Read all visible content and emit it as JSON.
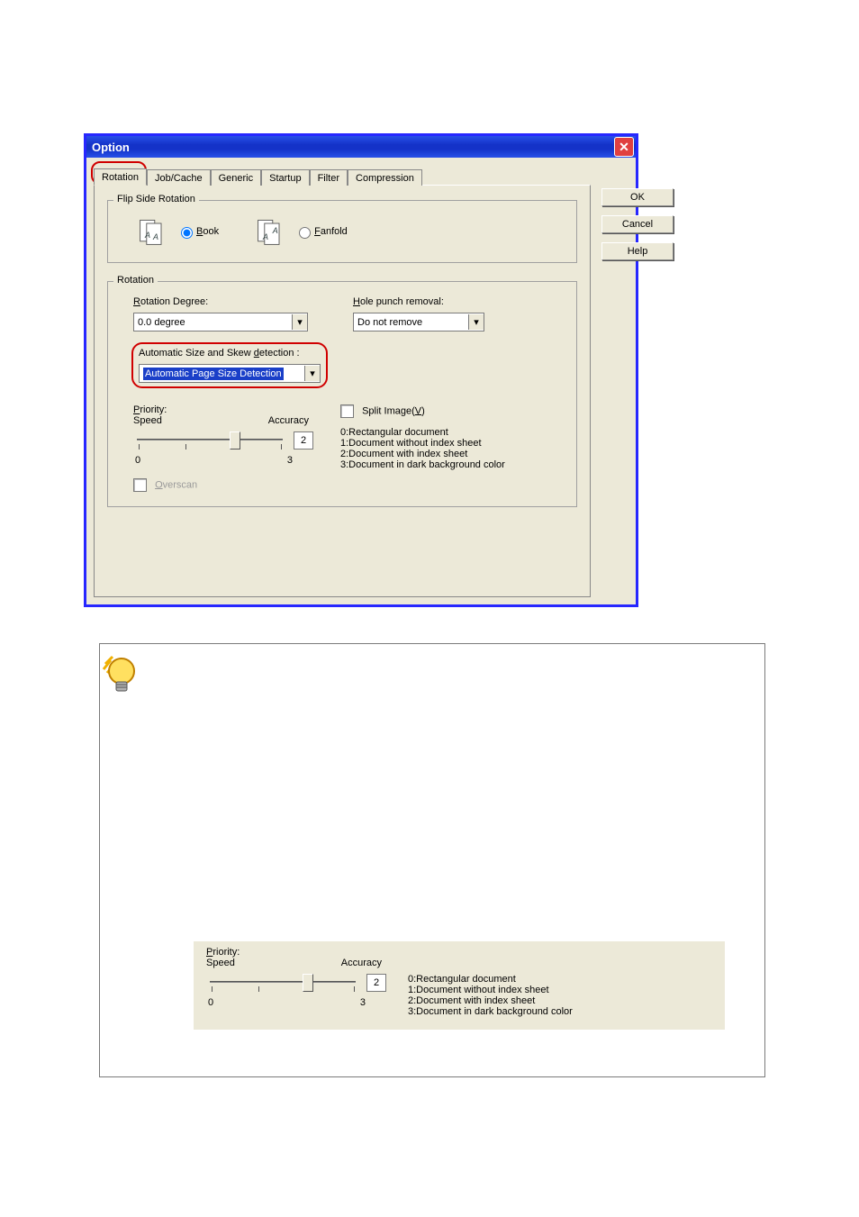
{
  "dialog": {
    "title": "Option",
    "close_icon": "close-icon",
    "tabs": [
      "Rotation",
      "Job/Cache",
      "Generic",
      "Startup",
      "Filter",
      "Compression"
    ],
    "active_tab_index": 0,
    "buttons": {
      "ok": "OK",
      "cancel": "Cancel",
      "help": "Help"
    },
    "flip": {
      "legend": "Flip Side Rotation",
      "book_label": "Book",
      "fanfold_label": "Fanfold",
      "selected": "book"
    },
    "rotation": {
      "legend": "Rotation",
      "degree_label": "Rotation Degree:",
      "degree_value": "0.0 degree",
      "hole_label": "Hole punch removal:",
      "hole_value": "Do not remove",
      "auto_label": "Automatic Size and Skew detection :",
      "auto_value": "Automatic Page Size Detection",
      "priority_label": "Priority:",
      "speed_label": "Speed",
      "accuracy_label": "Accuracy",
      "slider_value": "2",
      "slider_min": "0",
      "slider_max": "3",
      "overscan_label": "Overscan",
      "split_label": "Split Image(V)",
      "legend_lines": [
        "0:Rectangular document",
        "1:Document without index sheet",
        "2:Document with index sheet",
        "3:Document in dark background color"
      ]
    }
  },
  "note": {
    "priority_label": "Priority:",
    "speed_label": "Speed",
    "accuracy_label": "Accuracy",
    "slider_value": "2",
    "slider_min": "0",
    "slider_max": "3",
    "legend_lines": [
      "0:Rectangular document",
      "1:Document without index sheet",
      "2:Document with index sheet",
      "3:Document in dark background color"
    ]
  }
}
